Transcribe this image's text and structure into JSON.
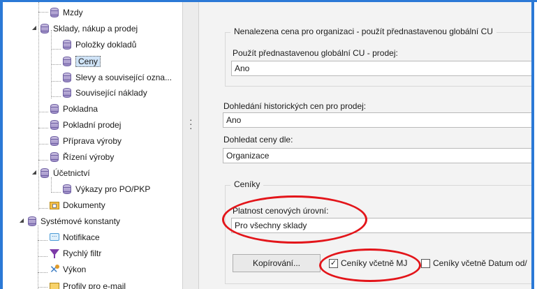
{
  "tree": {
    "items": [
      {
        "label": "Mzdy",
        "icon": "database-icon"
      },
      {
        "label": "Sklady, nákup a prodej",
        "icon": "database-icon"
      },
      {
        "label": "Položky dokladů",
        "icon": "database-icon"
      },
      {
        "label": "Ceny",
        "icon": "database-icon",
        "selected": true
      },
      {
        "label": "Slevy a související ozna...",
        "icon": "database-icon"
      },
      {
        "label": "Související náklady",
        "icon": "database-icon"
      },
      {
        "label": "Pokladna",
        "icon": "database-icon"
      },
      {
        "label": "Pokladní prodej",
        "icon": "database-icon"
      },
      {
        "label": "Příprava výroby",
        "icon": "database-icon"
      },
      {
        "label": "Řízení výroby",
        "icon": "database-icon"
      },
      {
        "label": "Účetnictví",
        "icon": "database-icon"
      },
      {
        "label": "Výkazy pro PO/PKP",
        "icon": "database-icon"
      },
      {
        "label": "Dokumenty",
        "icon": "documents-icon"
      },
      {
        "label": "Systémové konstanty",
        "icon": "database-icon"
      },
      {
        "label": "Notifikace",
        "icon": "notification-icon"
      },
      {
        "label": "Rychlý filtr",
        "icon": "filter-icon"
      },
      {
        "label": "Výkon",
        "icon": "tools-icon"
      },
      {
        "label": "Profily pro e-mail",
        "icon": "mail-icon"
      }
    ]
  },
  "form": {
    "group1": {
      "title": "Nenalezena cena pro organizaci - použít přednastavenou globální CU",
      "field_label": "Použít přednastavenou globální CU - prodej:",
      "field_value": "Ano"
    },
    "historic": {
      "label": "Dohledání historických cen pro prodej:",
      "value": "Ano"
    },
    "lookup": {
      "label": "Dohledat ceny dle:",
      "value": "Organizace"
    },
    "pricelists": {
      "title": "Ceníky",
      "validity_label": "Platnost cenových úrovní:",
      "validity_value": "Pro všechny sklady",
      "copy_button": "Kopírování...",
      "check1_label": "Ceníky včetně MJ",
      "check1_checked": true,
      "check2_label": "Ceníky včetně Datum od/",
      "check2_checked": false
    }
  },
  "colors": {
    "accent": "#2b79d6",
    "annotation": "#e3151a",
    "selection": "#cfe3f7"
  }
}
